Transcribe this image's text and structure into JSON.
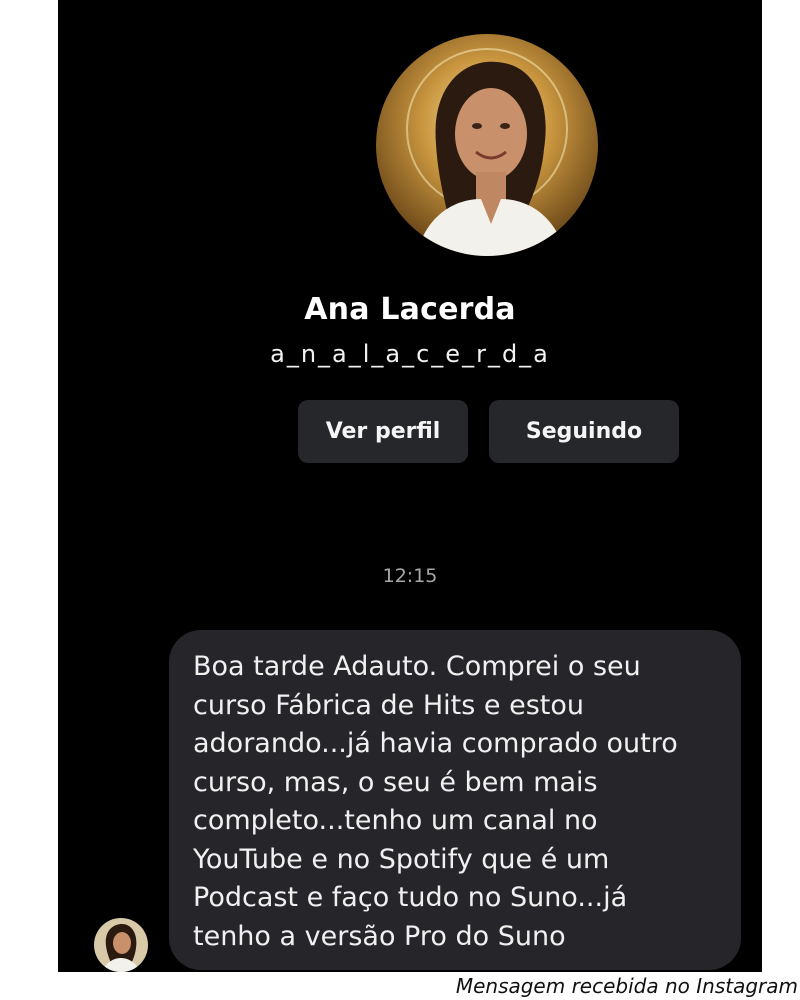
{
  "profile": {
    "name": "Ana Lacerda",
    "username": "a_n_a_l_a_c_e_r_d_a",
    "avatar_icon": "profile-photo"
  },
  "actions": {
    "view_profile_label": "Ver perfil",
    "following_label": "Seguindo"
  },
  "thread": {
    "timestamp": "12:15",
    "message": {
      "sender_avatar_icon": "profile-photo",
      "lines": [
        "Boa tarde Adauto. Comprei o seu",
        "curso Fábrica de Hits e estou",
        "adorando...já havia comprado outro",
        "curso, mas, o seu é bem mais",
        "completo...tenho um canal no",
        "YouTube e no Spotify que é um",
        "Podcast e faço tudo no Suno...já",
        "tenho a versão Pro do Suno"
      ]
    }
  },
  "caption": "Mensagem recebida no Instagram",
  "colors": {
    "background": "#000000",
    "button": "#26272b",
    "bubble": "#26262a",
    "timestamp": "#a8a8a8"
  }
}
